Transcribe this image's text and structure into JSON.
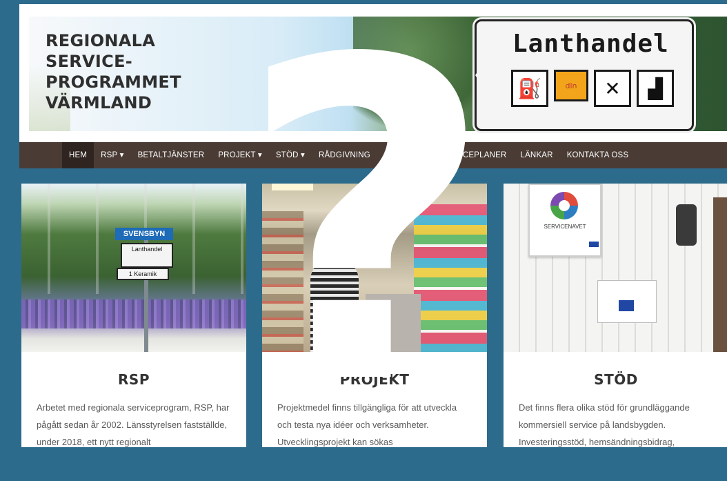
{
  "header": {
    "site_title": "REGIONALA\nSERVICE-\nPROGRAMMET\nVÄRMLAND",
    "sign_text": "Lanthandel",
    "sign_icons": [
      "fuel-icon",
      "dln-logo",
      "restaurant-icon",
      "animal-icon"
    ]
  },
  "nav": {
    "items": [
      {
        "label": "HEM",
        "active": true
      },
      {
        "label": "RSP ▾"
      },
      {
        "label": "BETALTJÄNSTER"
      },
      {
        "label": "PROJEKT ▾"
      },
      {
        "label": "STÖD ▾"
      },
      {
        "label": "RÅDGIVNING"
      },
      {
        "label": "KOMMUNALA SERVICEPLANER"
      },
      {
        "label": "LÄNKAR"
      },
      {
        "label": "KONTAKTA OSS"
      }
    ]
  },
  "cards": [
    {
      "title": "RSP",
      "text": "Arbetet med regionala serviceprogram, RSP, har pågått sedan år 2002. Länsstyrelsen fastställde, under 2018, ett nytt regionalt",
      "photo_signs": [
        "SVENSBYN",
        "Lanthandel",
        "1 Keramik"
      ]
    },
    {
      "title": "PROJEKT",
      "text": "Projektmedel finns tillgängliga för att utveckla och testa nya idéer och verksamheter. Utvecklingsprojekt kan sökas"
    },
    {
      "title": "STÖD",
      "text": "Det finns flera olika stöd för grundläggande kommersiell service på landsbygden. Investeringsstöd, hemsändningsbidrag,",
      "photo_sign": "SERVICENAVET"
    }
  ],
  "overlay": {
    "symbol": "?"
  },
  "colors": {
    "background": "#2d6b8c",
    "nav": "#4a3c35",
    "nav_active": "#2f241f"
  }
}
